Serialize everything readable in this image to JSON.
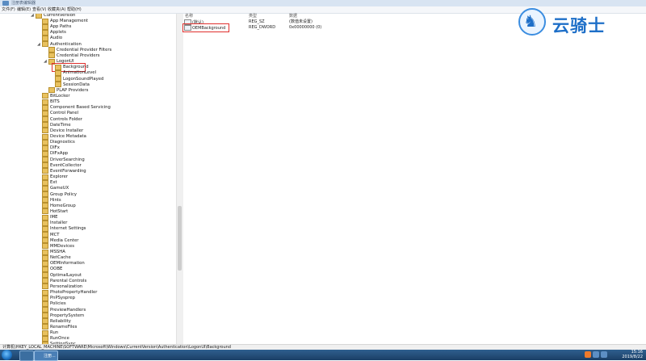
{
  "window": {
    "title": "注册表编辑器"
  },
  "menu": [
    "文件(F)",
    "编辑(E)",
    "查看(V)",
    "收藏夹(A)",
    "帮助(H)"
  ],
  "tree": {
    "root": "CurrentVersion",
    "items": [
      "App Management",
      "App Paths",
      "Applets",
      "Audio",
      "Authentication",
      "Credential Provider Filters",
      "Credential Providers",
      "LogonUI",
      "Background",
      "AnimationLevel",
      "LogonSoundPlayed",
      "SessionData",
      "PLAP Providers",
      "BitLocker",
      "BITS",
      "Component Based Servicing",
      "Control Panel",
      "Controls Folder",
      "DateTime",
      "Device Installer",
      "Device Metadata",
      "Diagnostics",
      "DIFx",
      "DIFxApp",
      "DriverSearching",
      "EventCollector",
      "EventForwarding",
      "Explorer",
      "Ext",
      "GameUX",
      "Group Policy",
      "Hints",
      "HomeGroup",
      "HotStart",
      "IME",
      "Installer",
      "Internet Settings",
      "MCT",
      "Media Center",
      "MMDevices",
      "MSSHA",
      "NetCache",
      "OEMInformation",
      "OOBE",
      "OptimalLayout",
      "Parental Controls",
      "Personalization",
      "PhotoPropertyHandler",
      "PnPSysprep",
      "Policies",
      "PreviewHandlers",
      "PropertySystem",
      "Reliability",
      "RenameFiles",
      "Run",
      "RunOnce",
      "SettingSync"
    ],
    "selected": "Background"
  },
  "list": {
    "headers": {
      "name": "名称",
      "type": "类型",
      "data": "数据"
    },
    "rows": [
      {
        "name": "(默认)",
        "type": "REG_SZ",
        "data": "(数值未设置)"
      },
      {
        "name": "OEMBackground",
        "type": "REG_DWORD",
        "data": "0x00000000 (0)"
      }
    ]
  },
  "status": {
    "path": "计算机\\HKEY_LOCAL_MACHINE\\SOFTWARE\\Microsoft\\Windows\\CurrentVersion\\Authentication\\LogonUI\\Background"
  },
  "taskbar": {
    "app_label": "注册...",
    "time": "15:16",
    "date": "2019/8/22"
  },
  "watermark": {
    "text": "云骑士"
  },
  "colors": {
    "highlight": "#e0302e",
    "accent": "#1e6fc8",
    "folder": "#e8c15e"
  }
}
